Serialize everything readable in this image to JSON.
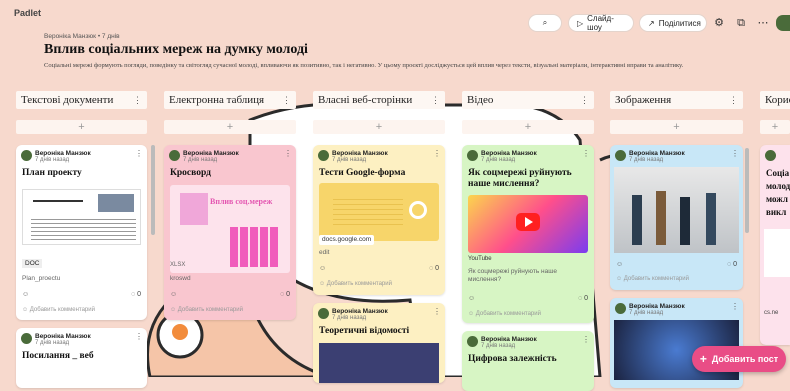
{
  "app": {
    "logo": "Padlet"
  },
  "toolbar": {
    "search_icon": "⌕",
    "slideshow_label": "Слайд-шоу",
    "share_label": "Поділитися",
    "settings_icon": "⚙",
    "fullscreen_icon": "⧉",
    "more_icon": "⋯"
  },
  "board": {
    "author_line": "Вероніка Манзюк • 7 днів",
    "title": "Вплив соціальних мереж на думку молоді",
    "description": "Соціальні мережі формують погляди, поведінку та світогляд сучасної молоді, впливаючи як позитивно, так і негативно. У цьому проєкті досліджується цей вплив через тексти, візуальні матеріали, інтерактивні вправи та аналітику."
  },
  "columns": [
    {
      "title": "Текстові документи"
    },
    {
      "title": "Електронна таблиця"
    },
    {
      "title": "Власні веб-сторінки"
    },
    {
      "title": "Відео"
    },
    {
      "title": "Зображення"
    },
    {
      "title": "Корис"
    }
  ],
  "card_common": {
    "author": "Вероніка Манзюк",
    "date": "7 днів назад",
    "comment_placeholder": "Добавить комментарий",
    "add": "+",
    "kebab": "⋮"
  },
  "cards": {
    "plan": {
      "title": "План проекту",
      "doc_tag": "DOC",
      "file": "Plan_proectu",
      "count": "0"
    },
    "posyl": {
      "title": "Посилання _ веб"
    },
    "krossword": {
      "title": "Кросворд",
      "banner": "Вплив соц.мереж",
      "tag": "XLSX",
      "file": "kroswd",
      "count": "0"
    },
    "google": {
      "title": "Тести Google-форма",
      "link": "docs.google.com",
      "sub": "edit",
      "count": "0"
    },
    "teor": {
      "title": "Теоретичні відомості"
    },
    "video": {
      "title": "Як соцмережі руйнують наше мислення?",
      "tag": "YouTube",
      "desc": "Як соцмережі руйнують наше мислення?",
      "count": "0"
    },
    "cyfr": {
      "title": "Цифрова залежність"
    },
    "img1": {
      "count": "0"
    },
    "kor": {
      "title": "Соціа молод можл викл",
      "domain": "cs.ne"
    }
  },
  "add_post": {
    "label": "Добавить пост",
    "icon": "+"
  }
}
